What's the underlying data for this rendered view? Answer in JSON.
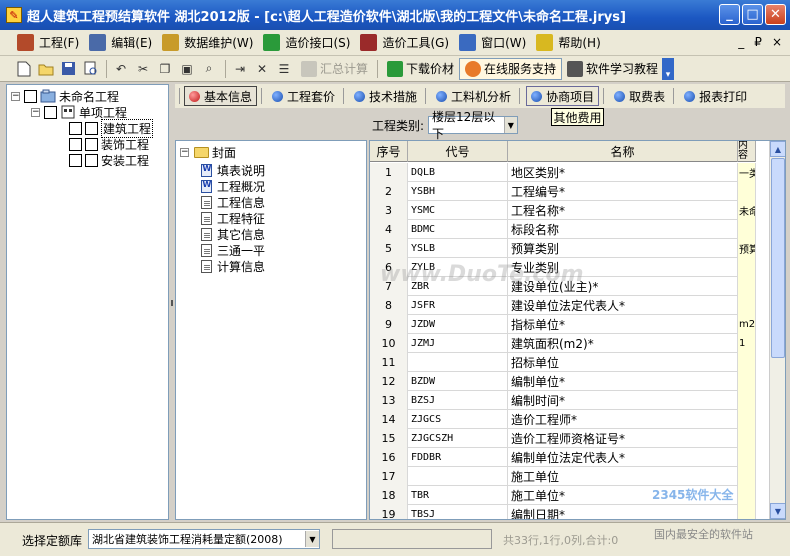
{
  "window": {
    "title": "超人建筑工程预结算软件 湖北2012版 - [c:\\超人工程造价软件\\湖北版\\我的工程文件\\未命名工程.jrys]",
    "minimize": "_",
    "maximize": "□",
    "close": "✕"
  },
  "menu": {
    "items": [
      {
        "label": "工程(F)",
        "icon": "project-icon",
        "color": "#b34a2a"
      },
      {
        "label": "编辑(E)",
        "icon": "edit-icon",
        "color": "#4a6aa8"
      },
      {
        "label": "数据维护(W)",
        "icon": "data-maintain-icon",
        "color": "#c89b2a"
      },
      {
        "label": "造价接口(S)",
        "icon": "interface-icon",
        "color": "#2a9a3a"
      },
      {
        "label": "造价工具(G)",
        "icon": "tools-icon",
        "color": "#9a2a2a"
      },
      {
        "label": "窗口(W)",
        "icon": "window-icon",
        "color": "#3a6ac0"
      },
      {
        "label": "帮助(H)",
        "icon": "help-icon",
        "color": "#d8b820"
      }
    ],
    "mdi": {
      "minimize": "_",
      "restore": "₽",
      "close": "×"
    }
  },
  "toolbar": {
    "calc": "汇总计算",
    "download": "下载价材",
    "online": "在线服务支持",
    "tutorial": "软件学习教程"
  },
  "tree": {
    "root": "未命名工程",
    "unit": "单项工程",
    "children": [
      "建筑工程",
      "装饰工程",
      "安装工程"
    ]
  },
  "tabs": [
    {
      "label": "基本信息",
      "active": true
    },
    {
      "label": "工程套价"
    },
    {
      "label": "技术措施"
    },
    {
      "label": "工料机分析"
    },
    {
      "label": "协商项目"
    },
    {
      "label": "取费表"
    },
    {
      "label": "报表打印"
    }
  ],
  "tooltip": "其他费用",
  "project_type": {
    "label": "工程类别:",
    "value": "楼层12层以下"
  },
  "cover": {
    "root": "封面",
    "items": [
      {
        "label": "填表说明",
        "icon": "word-doc-icon"
      },
      {
        "label": "工程概况",
        "icon": "word-doc-icon"
      },
      {
        "label": "工程信息",
        "icon": "doc-icon"
      },
      {
        "label": "工程特征",
        "icon": "doc-icon"
      },
      {
        "label": "其它信息",
        "icon": "doc-icon"
      },
      {
        "label": "三通一平",
        "icon": "doc-icon"
      },
      {
        "label": "计算信息",
        "icon": "doc-icon"
      }
    ]
  },
  "grid": {
    "headers": {
      "seq": "序号",
      "code": "代号",
      "name": "名称",
      "content": "内容"
    },
    "rows": [
      {
        "seq": "1",
        "code": "DQLB",
        "name": "地区类别*",
        "content": "一类"
      },
      {
        "seq": "2",
        "code": "YSBH",
        "name": "工程编号*",
        "content": ""
      },
      {
        "seq": "3",
        "code": "YSMC",
        "name": "工程名称*",
        "content": "未命"
      },
      {
        "seq": "4",
        "code": "BDMC",
        "name": "标段名称",
        "content": ""
      },
      {
        "seq": "5",
        "code": "YSLB",
        "name": "预算类别",
        "content": "预算"
      },
      {
        "seq": "6",
        "code": "ZYLB",
        "name": "专业类别",
        "content": ""
      },
      {
        "seq": "7",
        "code": "ZBR",
        "name": "建设单位(业主)*",
        "content": ""
      },
      {
        "seq": "8",
        "code": "JSFR",
        "name": "建设单位法定代表人*",
        "content": ""
      },
      {
        "seq": "9",
        "code": "JZDW",
        "name": "指标单位*",
        "content": "m2"
      },
      {
        "seq": "10",
        "code": "JZMJ",
        "name": "建筑面积(m2)*",
        "content": "1"
      },
      {
        "seq": "11",
        "code": "",
        "name": "招标单位",
        "content": ""
      },
      {
        "seq": "12",
        "code": "BZDW",
        "name": "编制单位*",
        "content": ""
      },
      {
        "seq": "13",
        "code": "BZSJ",
        "name": "编制时间*",
        "content": ""
      },
      {
        "seq": "14",
        "code": "ZJGCS",
        "name": "造价工程师*",
        "content": ""
      },
      {
        "seq": "15",
        "code": "ZJGCSZH",
        "name": "造价工程师资格证号*",
        "content": ""
      },
      {
        "seq": "16",
        "code": "FDDBR",
        "name": "编制单位法定代表人*",
        "content": ""
      },
      {
        "seq": "17",
        "code": "",
        "name": "施工单位",
        "content": ""
      },
      {
        "seq": "18",
        "code": "TBR",
        "name": "施工单位*",
        "content": ""
      },
      {
        "seq": "19",
        "code": "TBSJ",
        "name": "编制日期*",
        "content": ""
      }
    ]
  },
  "status": {
    "select_label": "选择定额库",
    "quota_lib": "湖北省建筑装饰工程消耗量定额(2008)",
    "info": "共33行,1行,0列,合计:0"
  },
  "watermarks": {
    "brand": "2345软件大全",
    "slogan": "国内最安全的软件站",
    "center": "www.DuoTe.com"
  }
}
